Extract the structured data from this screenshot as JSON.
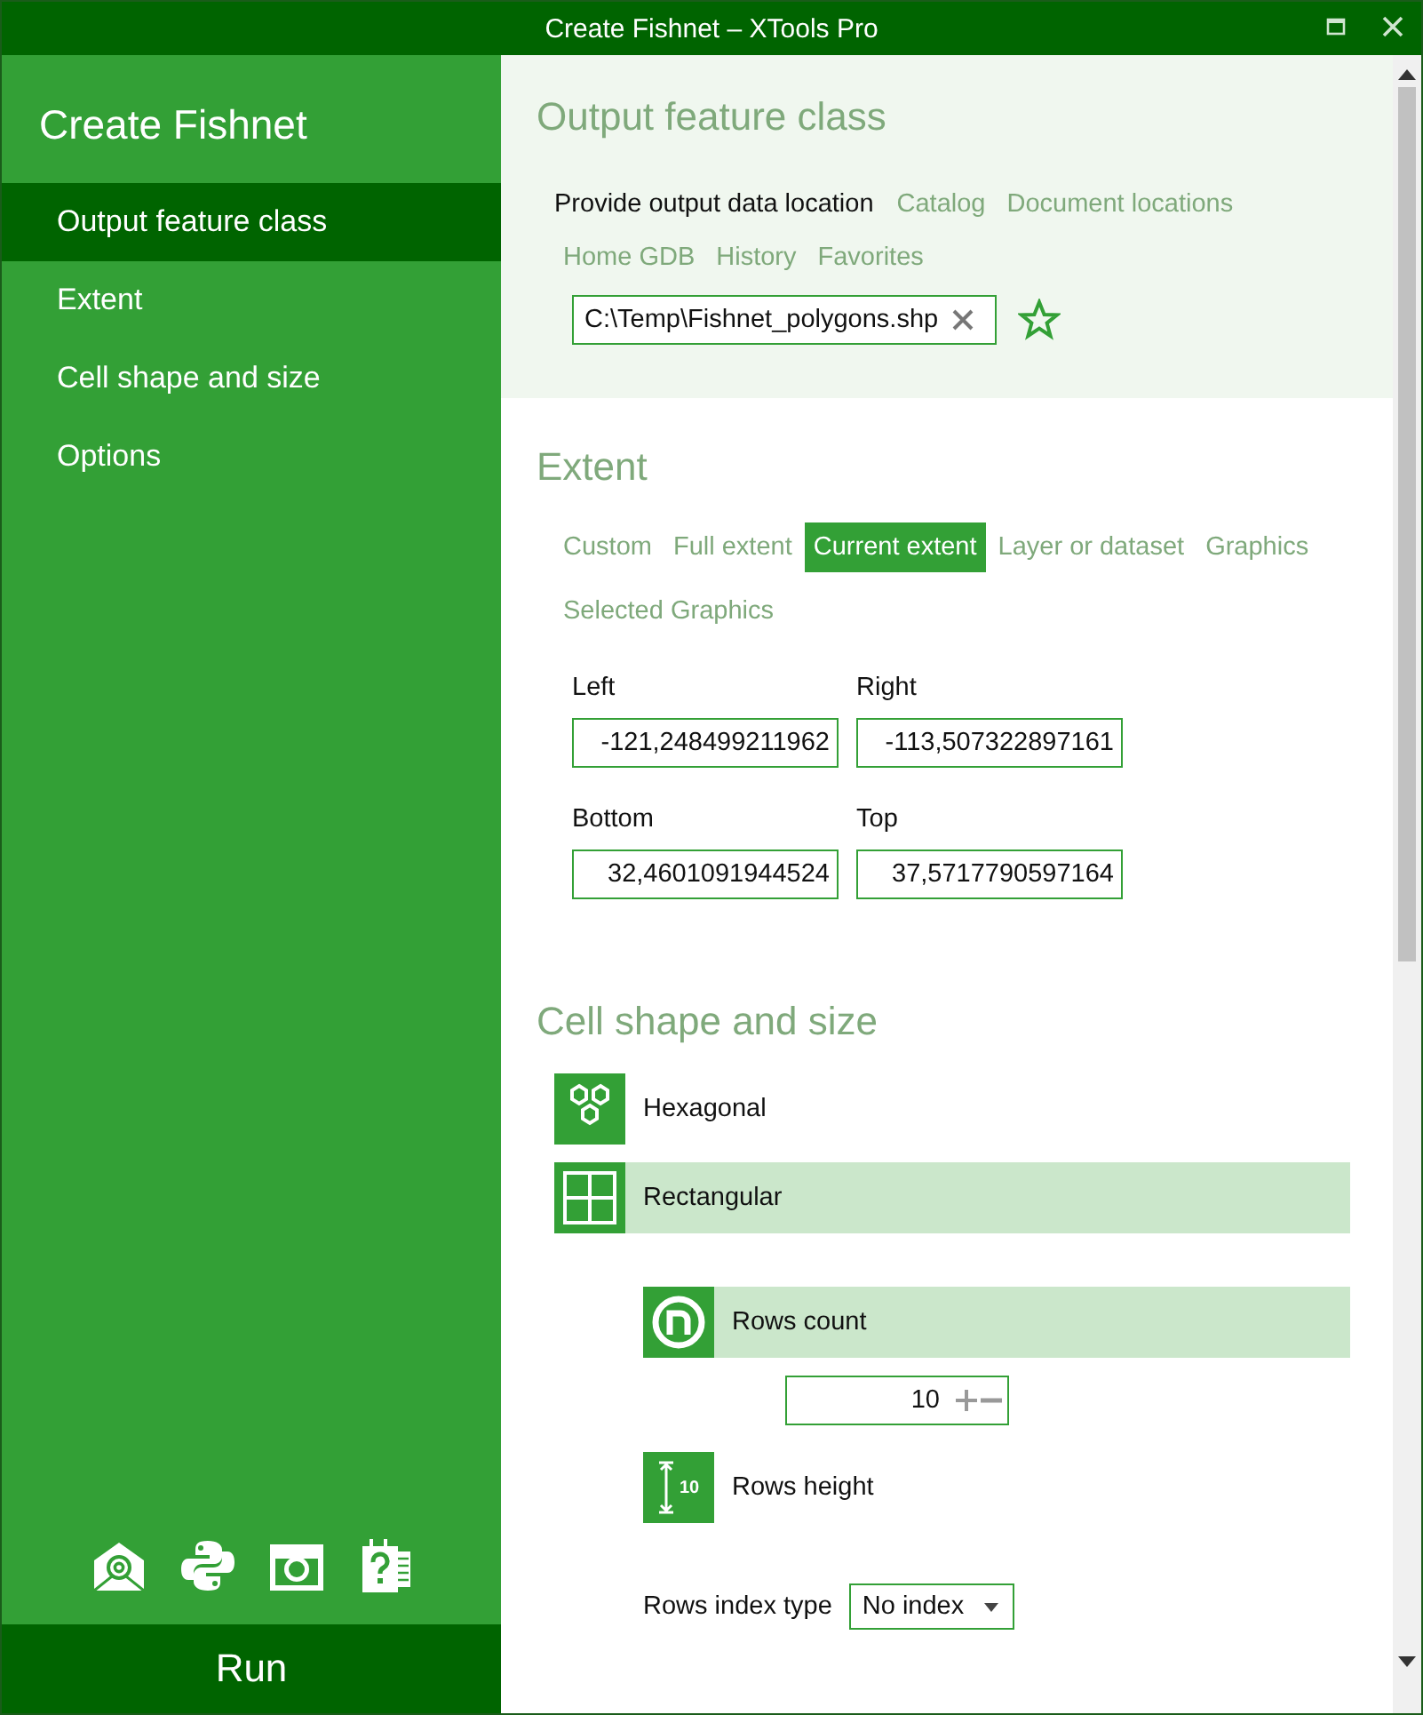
{
  "window": {
    "title": "Create Fishnet – XTools Pro"
  },
  "sidebar": {
    "title": "Create Fishnet",
    "items": [
      {
        "label": "Output feature class",
        "selected": true
      },
      {
        "label": "Extent",
        "selected": false
      },
      {
        "label": "Cell shape and size",
        "selected": false
      },
      {
        "label": "Options",
        "selected": false
      }
    ],
    "run_button": "Run"
  },
  "output": {
    "heading": "Output feature class",
    "prompt": "Provide output data location",
    "links": [
      "Catalog",
      "Document locations",
      "Home GDB",
      "History",
      "Favorites"
    ],
    "path": "C:\\Temp\\Fishnet_polygons.shp"
  },
  "extent": {
    "heading": "Extent",
    "options": [
      {
        "label": "Custom",
        "selected": false
      },
      {
        "label": "Full extent",
        "selected": false
      },
      {
        "label": "Current extent",
        "selected": true
      },
      {
        "label": "Layer or dataset",
        "selected": false
      },
      {
        "label": "Graphics",
        "selected": false
      },
      {
        "label": "Selected Graphics",
        "selected": false
      }
    ],
    "fields": [
      {
        "label": "Left",
        "value": "-121,248499211962"
      },
      {
        "label": "Right",
        "value": "-113,507322897161"
      },
      {
        "label": "Bottom",
        "value": "32,4601091944524"
      },
      {
        "label": "Top",
        "value": "37,5717790597164"
      }
    ]
  },
  "cell": {
    "heading": "Cell shape and size",
    "shapes": [
      {
        "kind": "hexagonal",
        "label": "Hexagonal",
        "selected": false
      },
      {
        "kind": "rectangular",
        "label": "Rectangular",
        "selected": true
      }
    ],
    "rows_count": {
      "label": "Rows count",
      "selected": true,
      "value": "10"
    },
    "rows_height": {
      "label": "Rows height",
      "icon_text": "10",
      "selected": false
    },
    "rows_index_type": {
      "label": "Rows index type",
      "value": "No index"
    }
  }
}
